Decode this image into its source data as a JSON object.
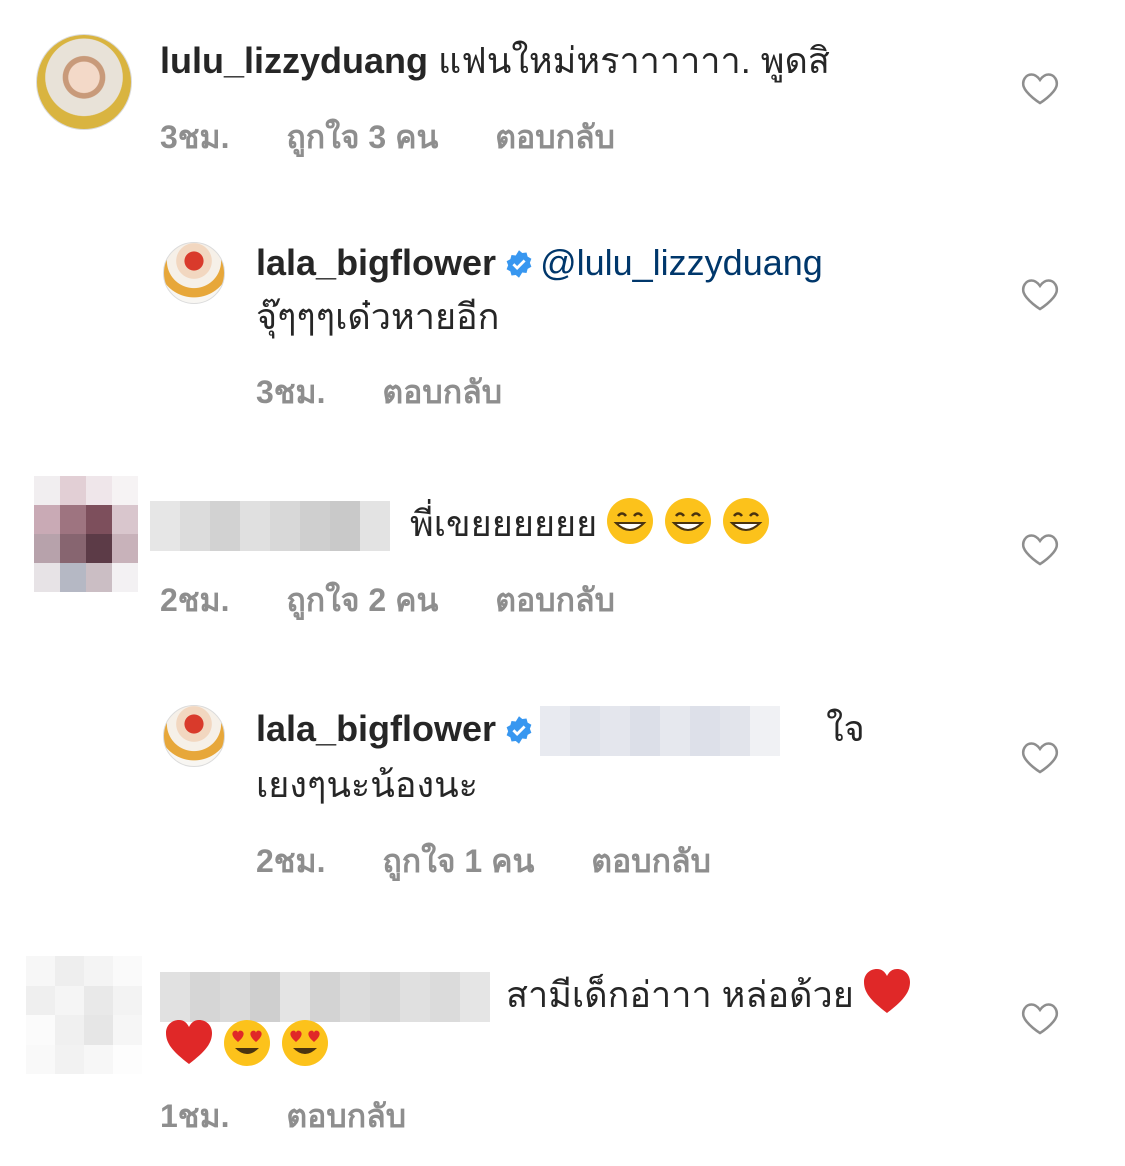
{
  "comments": [
    {
      "username": "lulu_lizzyduang",
      "text": "แฟนใหม่หราาาาาา.  พูดสิ",
      "time": "3ชม.",
      "likes": "ถูกใจ 3 คน",
      "reply": "ตอบกลับ"
    },
    {
      "username": "lala_bigflower",
      "mention": "@lulu_lizzyduang",
      "text": "จุ๊ๆๆๆเด๋วหายอีก",
      "time": "3ชม.",
      "reply": "ตอบกลับ"
    },
    {
      "text": "พี่เขยยยยยย",
      "time": "2ชม.",
      "likes": "ถูกใจ 2 คน",
      "reply": "ตอบกลับ"
    },
    {
      "username": "lala_bigflower",
      "text_line1": "ใจ",
      "text_line2": "เยงๆนะน้องนะ",
      "time": "2ชม.",
      "likes": "ถูกใจ 1 คน",
      "reply": "ตอบกลับ"
    },
    {
      "text": "สามีเด็กอ่าาา หล่อด้วย",
      "time": "1ชม.",
      "reply": "ตอบกลับ"
    }
  ],
  "colors": {
    "username": "#262626",
    "mention": "#00376b",
    "meta": "#8e8e8e",
    "verified": "#3897f0"
  },
  "icons": [
    "heart-outline-icon",
    "verified-badge-icon",
    "grinning-emoji",
    "heart-eyes-emoji",
    "red-heart-emoji"
  ]
}
